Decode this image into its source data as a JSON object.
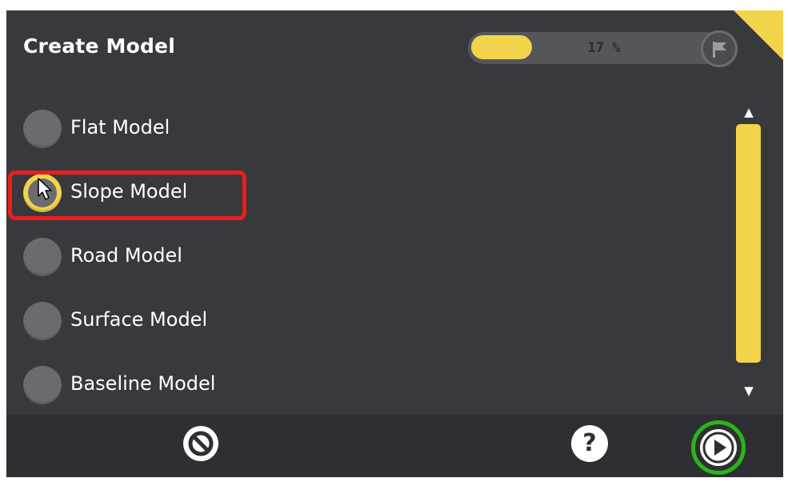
{
  "header": {
    "title": "Create Model",
    "progress_text": "17 %",
    "progress_fraction": 0.17,
    "flag_icon": "flag-icon"
  },
  "options": [
    {
      "label": "Flat Model",
      "selected": false
    },
    {
      "label": "Slope Model",
      "selected": true
    },
    {
      "label": "Road Model",
      "selected": false
    },
    {
      "label": "Surface Model",
      "selected": false
    },
    {
      "label": "Baseline Model",
      "selected": false
    }
  ],
  "scrollbar": {
    "up_glyph": "▲",
    "down_glyph": "▼"
  },
  "footer": {
    "cancel_icon": "cancel-icon",
    "help_label": "?",
    "next_icon": "play-icon"
  },
  "colors": {
    "background": "#38393d",
    "accent": "#f2d44a",
    "highlight": "#ee1c1c",
    "next_ring": "#28b51d"
  }
}
